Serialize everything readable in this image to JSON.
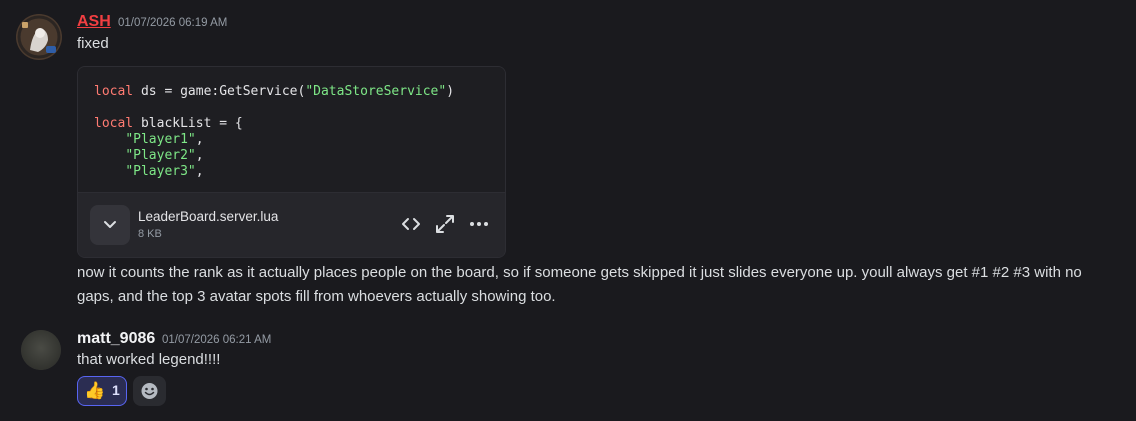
{
  "messages": [
    {
      "username": "ASH",
      "timestamp": "01/07/2026 06:19 AM",
      "text": "fixed",
      "username_color": "#f23f42",
      "attachment": {
        "code_lines": [
          {
            "segments": [
              {
                "t": "local",
                "c": "kw"
              },
              {
                "t": " ds = game:GetService(",
                "c": ""
              },
              {
                "t": "\"DataStoreService\"",
                "c": "str"
              },
              {
                "t": ")",
                "c": ""
              }
            ]
          },
          {
            "segments": [
              {
                "t": "",
                "c": ""
              }
            ]
          },
          {
            "segments": [
              {
                "t": "local",
                "c": "kw"
              },
              {
                "t": " blackList = {",
                "c": ""
              }
            ]
          },
          {
            "segments": [
              {
                "t": "    ",
                "c": ""
              },
              {
                "t": "\"Player1\"",
                "c": "str"
              },
              {
                "t": ",",
                "c": ""
              }
            ]
          },
          {
            "segments": [
              {
                "t": "    ",
                "c": ""
              },
              {
                "t": "\"Player2\"",
                "c": "str"
              },
              {
                "t": ",",
                "c": ""
              }
            ]
          },
          {
            "segments": [
              {
                "t": "    ",
                "c": ""
              },
              {
                "t": "\"Player3\"",
                "c": "str"
              },
              {
                "t": ",",
                "c": ""
              }
            ]
          }
        ],
        "file_name": "LeaderBoard.server.lua",
        "file_size": "8 KB",
        "icons": [
          "chevron-down-icon",
          "code-icon",
          "expand-icon",
          "more-icon"
        ]
      },
      "followup_text_line1": "now it counts the rank as it actually places people on the board, so if someone gets skipped it just slides everyone up. youll always get #1 #2 #3 with no",
      "followup_text_line2": "gaps, and the top 3 avatar spots fill from whoevers actually showing too."
    },
    {
      "username": "matt_9086",
      "timestamp": "01/07/2026 06:21 AM",
      "text": "that worked legend!!!!",
      "username_color": "#f2f3f5",
      "reactions": [
        {
          "emoji": "👍",
          "count": "1",
          "icon": "thumbs-up-icon"
        },
        {
          "icon": "add-reaction-icon"
        }
      ]
    }
  ],
  "colors": {
    "background": "#1a1a1e",
    "reaction_active_border": "#5865f2",
    "reaction_active_bg": "#2b2d52"
  }
}
